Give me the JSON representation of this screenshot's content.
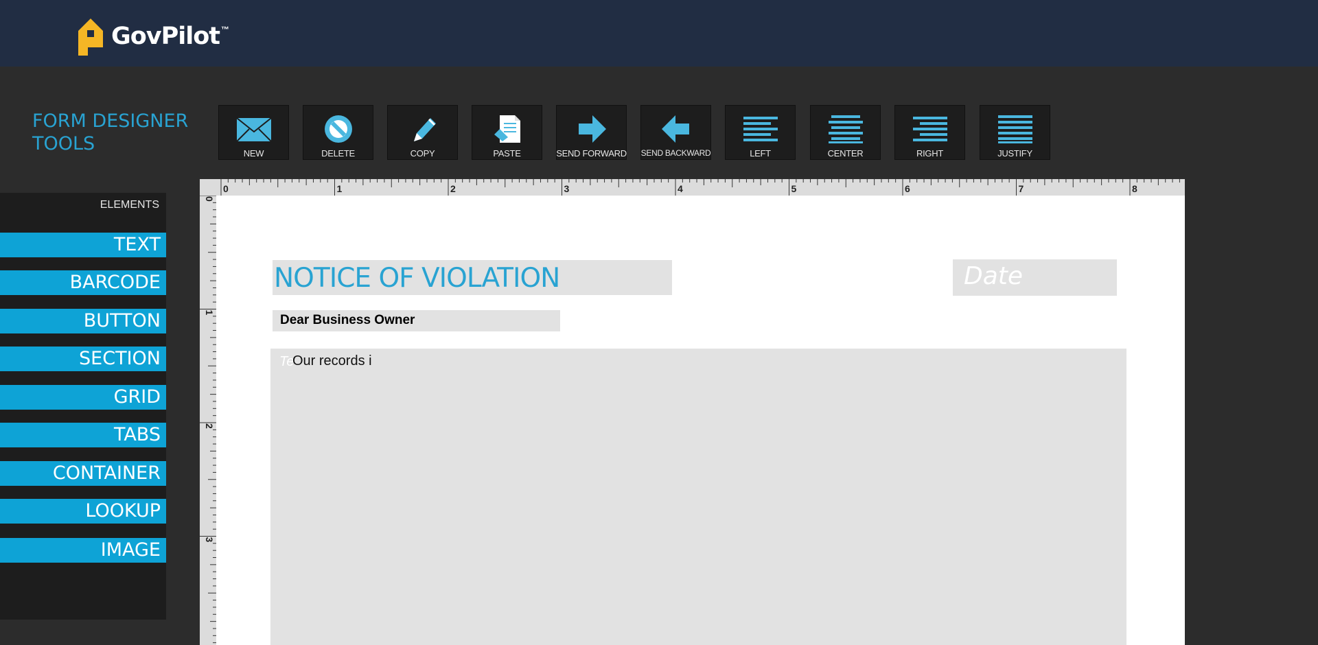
{
  "header": {
    "brand": "GovPilot",
    "trademark": "™",
    "bg_color": "#212d43",
    "logo_color": "#f5b625"
  },
  "tools": {
    "title_line1": "FORM DESIGNER",
    "title_line2": "TOOLS",
    "buttons": [
      {
        "label": "NEW",
        "icon": "envelope-icon"
      },
      {
        "label": "DELETE",
        "icon": "no-entry-icon"
      },
      {
        "label": "COPY",
        "icon": "pencil-icon"
      },
      {
        "label": "PASTE",
        "icon": "paste-document-icon"
      },
      {
        "label": "SEND FORWARD",
        "icon": "arrow-right-icon"
      },
      {
        "label": "SEND BACKWARD",
        "icon": "arrow-left-icon"
      },
      {
        "label": "LEFT",
        "icon": "align-left-icon"
      },
      {
        "label": "CENTER",
        "icon": "align-center-icon"
      },
      {
        "label": "RIGHT",
        "icon": "align-right-icon"
      },
      {
        "label": "JUSTIFY",
        "icon": "align-justify-icon"
      }
    ]
  },
  "sidebar": {
    "heading": "ELEMENTS",
    "items": [
      "TEXT",
      "BARCODE",
      "BUTTON",
      "SECTION",
      "GRID",
      "TABS",
      "CONTAINER",
      "LOOKUP",
      "IMAGE"
    ]
  },
  "ruler": {
    "top_labels": [
      "0",
      "1",
      "2",
      "3",
      "4",
      "5",
      "6",
      "7",
      "8"
    ],
    "left_labels": [
      "0",
      "1",
      "2",
      "3"
    ]
  },
  "form": {
    "title": "NOTICE OF VIOLATION",
    "date_placeholder": "Date",
    "greeting": "Dear Business Owner",
    "body_ghost": "Te",
    "body_text": "Our records i"
  },
  "colors": {
    "accent": "#29a3d2",
    "sidebar_button": "#0ea3d6",
    "field_bg": "#e2e2e2",
    "panel_bg": "#1d1d1d",
    "workspace_bg": "#2c2c2c"
  }
}
